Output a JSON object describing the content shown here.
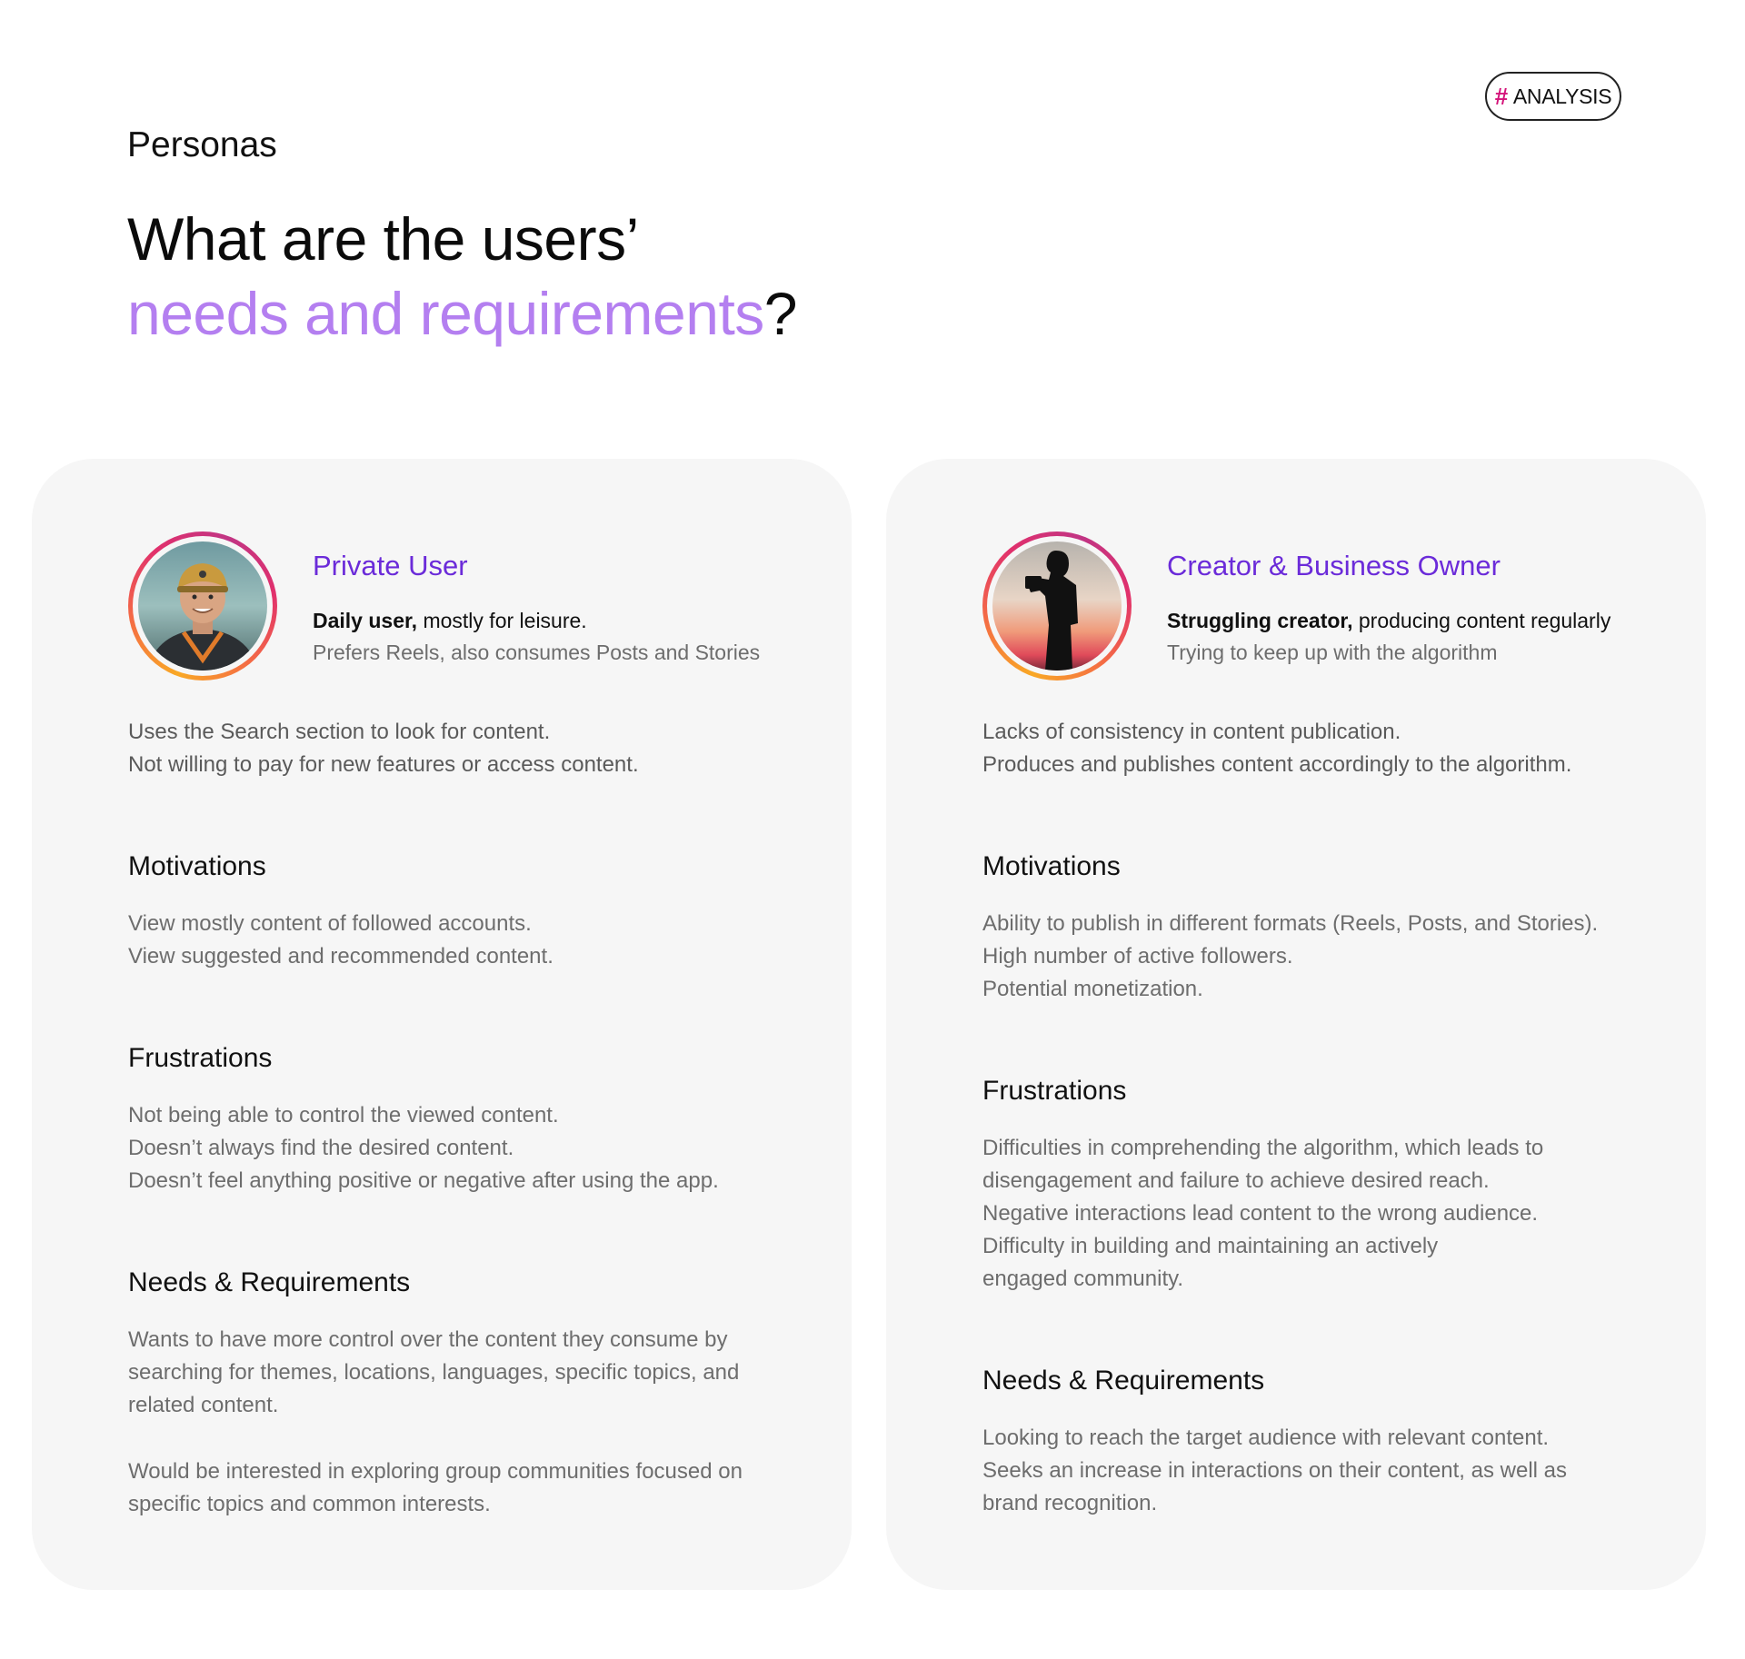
{
  "tag": {
    "hash": "#",
    "label": "ANALYSIS"
  },
  "section_label": "Personas",
  "headline": {
    "line1": "What are the users’",
    "accent": "needs and requirements",
    "suffix": "?"
  },
  "personas": [
    {
      "name": "Private User",
      "tagline_bold": "Daily user,",
      "tagline_rest": " mostly for leisure.",
      "subline": "Prefers Reels, also consumes Posts and Stories",
      "intro": [
        "Uses the Search section to look for content.",
        "Not willing to pay for new features or access content."
      ],
      "motivations_title": "Motivations",
      "motivations": [
        "View mostly content of followed accounts.",
        "View suggested and recommended content."
      ],
      "frustrations_title": "Frustrations",
      "frustrations": [
        "Not being able to control the viewed content.",
        "Doesn’t always find the desired content.",
        "Doesn’t feel anything positive or negative after using the app."
      ],
      "needs_title": "Needs & Requirements",
      "needs": [
        "Wants to have more control over the content they consume by",
        "searching for themes, locations, languages, specific topics, and",
        "related content."
      ],
      "needs_extra": [
        "Would be interested in exploring group communities focused on",
        "specific topics and common interests."
      ]
    },
    {
      "name": "Creator & Business Owner",
      "tagline_bold": "Struggling creator,",
      "tagline_rest": " producing content regularly",
      "subline": "Trying to keep up with the algorithm",
      "intro": [
        "Lacks of consistency in content publication.",
        "Produces and publishes content accordingly to the algorithm."
      ],
      "motivations_title": "Motivations",
      "motivations": [
        "Ability to publish in different formats (Reels, Posts, and Stories).",
        "High number of active followers.",
        "Potential monetization."
      ],
      "frustrations_title": "Frustrations",
      "frustrations": [
        "Difficulties in comprehending the algorithm, which leads to",
        "disengagement and failure to achieve desired reach.",
        "Negative interactions lead content to the wrong audience.",
        "Difficulty in building and maintaining an actively",
        "engaged community."
      ],
      "needs_title": "Needs & Requirements",
      "needs": [
        "Looking to reach the target audience with relevant content.",
        "Seeks an increase in interactions on their content, as well as",
        "brand recognition."
      ]
    }
  ],
  "colors": {
    "accent_purple": "#b47ff0",
    "name_purple": "#6b2bd9",
    "hash_pink": "#d4147a",
    "card_bg": "#f6f6f6"
  }
}
